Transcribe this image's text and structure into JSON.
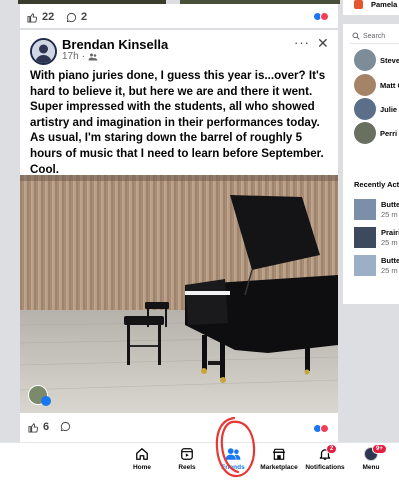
{
  "previous_post": {
    "likes": "22",
    "comments": "2"
  },
  "post": {
    "author": "Brendan Kinsella",
    "time": "17h",
    "separator": "·",
    "text": "With piano juries done, I guess this year is...over? It's hard to believe it, but here we are and there it went. Super impressed with the students, all who showed artistry and imagination in their performances today. As usual, I'm staring down the barrel of roughly 5 hours of music that I need to learn before September. Cool.",
    "more_glyph": "···",
    "close_glyph": "✕",
    "likes": "6"
  },
  "sidebar": {
    "top_name": "Pamela",
    "search_placeholder": "Search",
    "contacts": [
      {
        "name": "Steve"
      },
      {
        "name": "Matt C"
      },
      {
        "name": "Julie I"
      },
      {
        "name": "Perri I"
      }
    ],
    "recent_title": "Recently Acti",
    "recent": [
      {
        "title": "Butte",
        "sub": "25 m"
      },
      {
        "title": "Prairi",
        "sub": "25 m"
      },
      {
        "title": "Butte",
        "sub": "25 m"
      }
    ]
  },
  "bottom_nav": {
    "items": [
      {
        "label": "Home",
        "icon": "home-icon"
      },
      {
        "label": "Reels",
        "icon": "reels-icon"
      },
      {
        "label": "Friends",
        "icon": "friends-icon",
        "active": true
      },
      {
        "label": "Marketplace",
        "icon": "marketplace-icon"
      },
      {
        "label": "Notifications",
        "icon": "bell-icon",
        "badge": "2"
      },
      {
        "label": "Menu",
        "icon": "menu-avatar-icon",
        "badge": "9+"
      }
    ]
  },
  "colors": {
    "accent": "#1877f2",
    "badge": "#e41e3f",
    "annotation": "#e53935"
  }
}
